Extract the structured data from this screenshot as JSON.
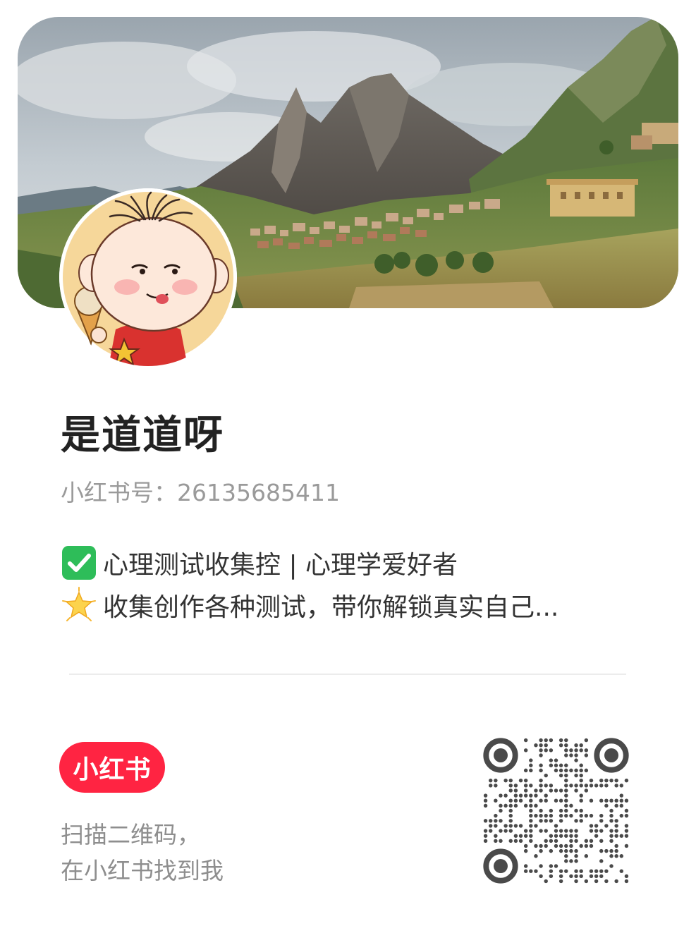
{
  "profile": {
    "nickname": "是道道呀",
    "account_label": "小红书号：",
    "account_id": "26135685411"
  },
  "bio": {
    "line1": "心理测试收集控 | 心理学爱好者",
    "line2": "收集创作各种测试，带你解锁真实自己...",
    "line1_icon": "check-mark-button-icon",
    "line2_icon": "glowing-star-icon"
  },
  "footer": {
    "logo_text": "小红书",
    "scan_line1": "扫描二维码，",
    "scan_line2": "在小红书找到我"
  },
  "colors": {
    "brand_red": "#ff2442",
    "text_dark": "#222222",
    "text_muted": "#9a9a9a",
    "check_green": "#2ebd59"
  }
}
